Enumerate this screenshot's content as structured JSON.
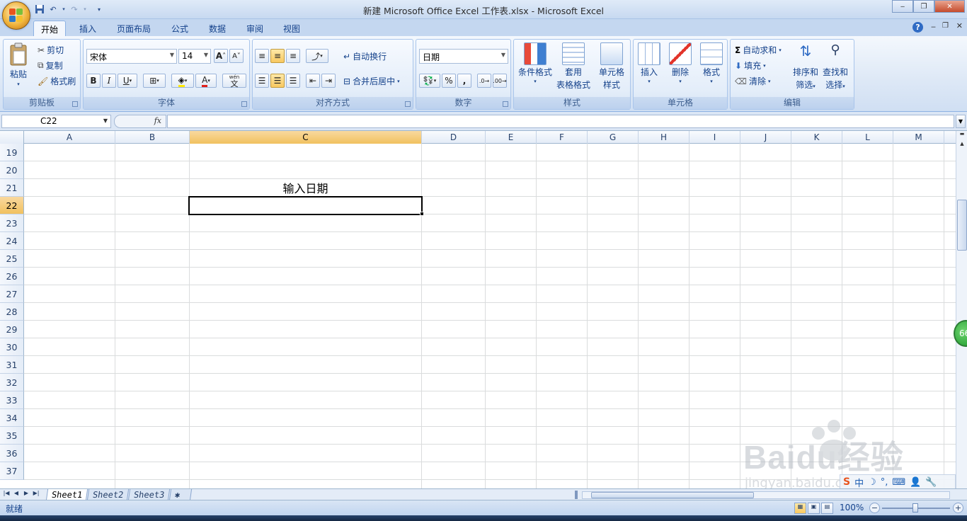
{
  "window": {
    "title": "新建 Microsoft Office Excel 工作表.xlsx - Microsoft Excel"
  },
  "tabs": [
    "开始",
    "插入",
    "页面布局",
    "公式",
    "数据",
    "审阅",
    "视图"
  ],
  "ribbon": {
    "clipboard": {
      "paste": "粘贴",
      "cut": "剪切",
      "copy": "复制",
      "format_painter": "格式刷",
      "label": "剪贴板"
    },
    "font": {
      "name": "宋体",
      "size": "14",
      "bold": "B",
      "italic": "I",
      "underline": "U",
      "grow": "A",
      "shrink": "A",
      "color_letter": "A",
      "phonetic": "wén",
      "phonetic_char": "文",
      "label": "字体"
    },
    "alignment": {
      "wrap": "自动换行",
      "merge": "合并后居中",
      "label": "对齐方式"
    },
    "number": {
      "format": "日期",
      "percent": "%",
      "comma": ",",
      "label": "数字"
    },
    "styles": {
      "conditional": "条件格式",
      "table_1": "套用",
      "table_2": "表格格式",
      "cell_1": "单元格",
      "cell_2": "样式",
      "label": "样式"
    },
    "cells": {
      "insert": "插入",
      "delete": "删除",
      "format": "格式",
      "label": "单元格"
    },
    "editing": {
      "autosum": "自动求和",
      "fill": "填充",
      "clear": "清除",
      "sort_1": "排序和",
      "sort_2": "筛选",
      "find_1": "查找和",
      "find_2": "选择",
      "label": "编辑"
    }
  },
  "formula_bar": {
    "name_box": "C22",
    "fx": "fx",
    "content": ""
  },
  "columns": [
    "A",
    "B",
    "C",
    "D",
    "E",
    "F",
    "G",
    "H",
    "I",
    "J",
    "K",
    "L",
    "M"
  ],
  "rows": [
    "19",
    "20",
    "21",
    "22",
    "23",
    "24",
    "25",
    "26",
    "27",
    "28",
    "29",
    "30",
    "31",
    "32",
    "33",
    "34",
    "35",
    "36",
    "37"
  ],
  "selected": {
    "column": "C",
    "row": "22"
  },
  "cells": {
    "C21": "输入日期"
  },
  "sheets": [
    "Sheet1",
    "Sheet2",
    "Sheet3"
  ],
  "status": {
    "mode": "就绪",
    "zoom": "100%"
  },
  "badge": "66",
  "watermark": {
    "brand": "Baidu经验",
    "url": "jingyan.baidu.com"
  },
  "ime": {
    "lang": "中"
  }
}
